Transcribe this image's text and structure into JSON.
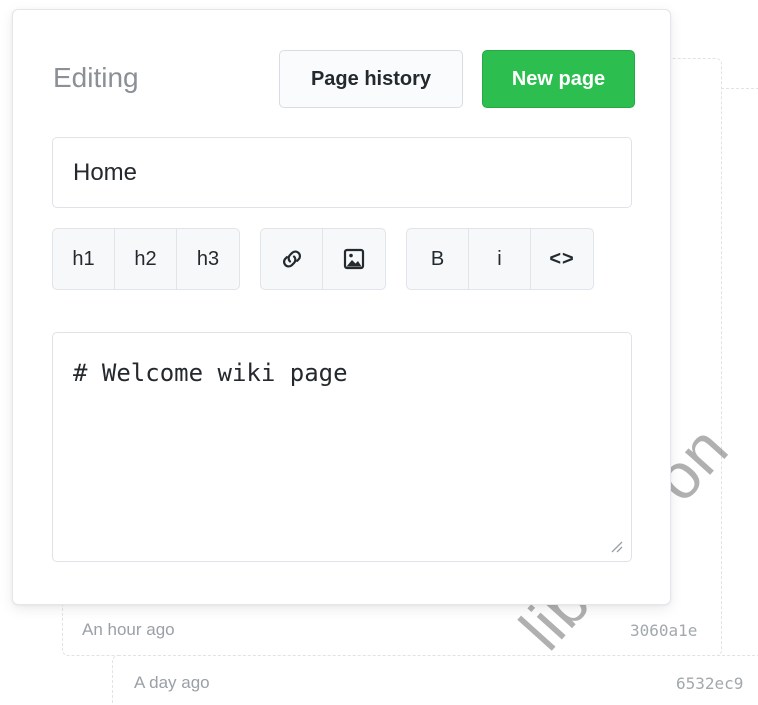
{
  "editor": {
    "heading": "Editing",
    "page_history_label": "Page history",
    "new_page_label": "New page",
    "title_value": "Home",
    "body_value": "# Welcome wiki page",
    "toolbar": {
      "headings": [
        "h1",
        "h2",
        "h3"
      ],
      "insert_icons": [
        "link-icon",
        "image-icon"
      ],
      "format": {
        "bold": "B",
        "italic": "i",
        "code": "<>"
      }
    }
  },
  "history": [
    {
      "time": "An hour ago",
      "sha": "3060a1e"
    },
    {
      "time": "A day ago",
      "sha": "6532ec9"
    }
  ],
  "watermark": "library on",
  "colors": {
    "primary_green": "#2cbe4e",
    "muted_text": "#8a9096"
  }
}
